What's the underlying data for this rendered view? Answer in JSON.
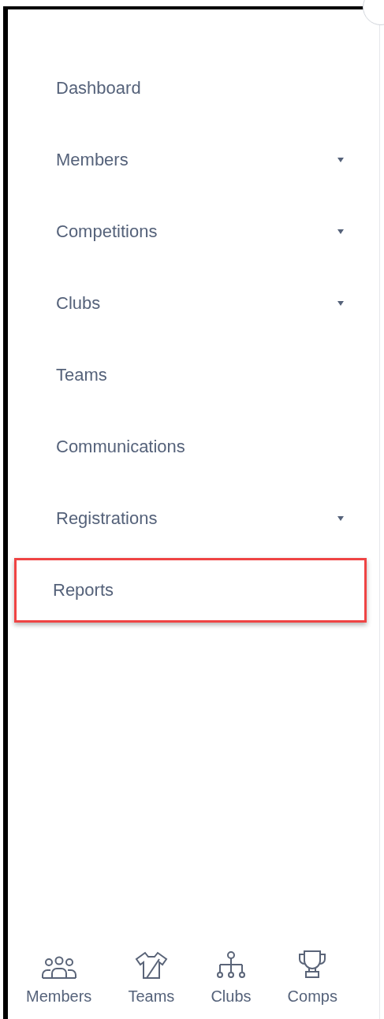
{
  "menu": [
    {
      "label": "Dashboard",
      "has_submenu": false,
      "highlighted": false
    },
    {
      "label": "Members",
      "has_submenu": true,
      "highlighted": false
    },
    {
      "label": "Competitions",
      "has_submenu": true,
      "highlighted": false
    },
    {
      "label": "Clubs",
      "has_submenu": true,
      "highlighted": false
    },
    {
      "label": "Teams",
      "has_submenu": false,
      "highlighted": false
    },
    {
      "label": "Communications",
      "has_submenu": false,
      "highlighted": false
    },
    {
      "label": "Registrations",
      "has_submenu": true,
      "highlighted": false
    },
    {
      "label": "Reports",
      "has_submenu": false,
      "highlighted": true
    }
  ],
  "bottom_nav": [
    {
      "kind": "members",
      "label": "Members"
    },
    {
      "kind": "teams",
      "label": "Teams"
    },
    {
      "kind": "clubs",
      "label": "Clubs"
    },
    {
      "kind": "comps",
      "label": "Comps"
    }
  ]
}
